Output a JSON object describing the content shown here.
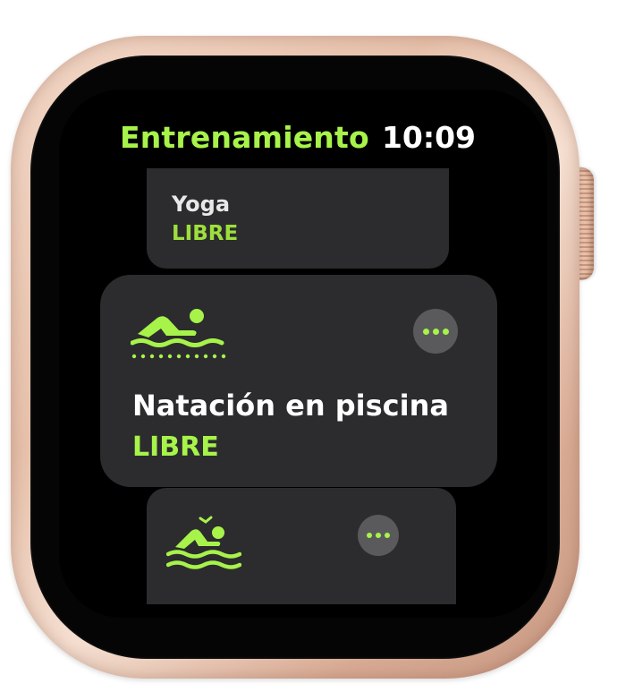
{
  "app": {
    "title": "Entrenamiento",
    "time": "10:09"
  },
  "workouts": [
    {
      "name": "Yoga",
      "goal": "LIBRE",
      "icon": "yoga-icon"
    },
    {
      "name": "Natación en piscina",
      "goal": "LIBRE",
      "icon": "pool-swim-icon"
    },
    {
      "name": "",
      "goal": "",
      "icon": "open-water-swim-icon"
    }
  ],
  "colors": {
    "accent": "#a7f34a",
    "card_background": "#2c2c2e",
    "screen_background": "#000000",
    "case": "#e7c1ab"
  }
}
